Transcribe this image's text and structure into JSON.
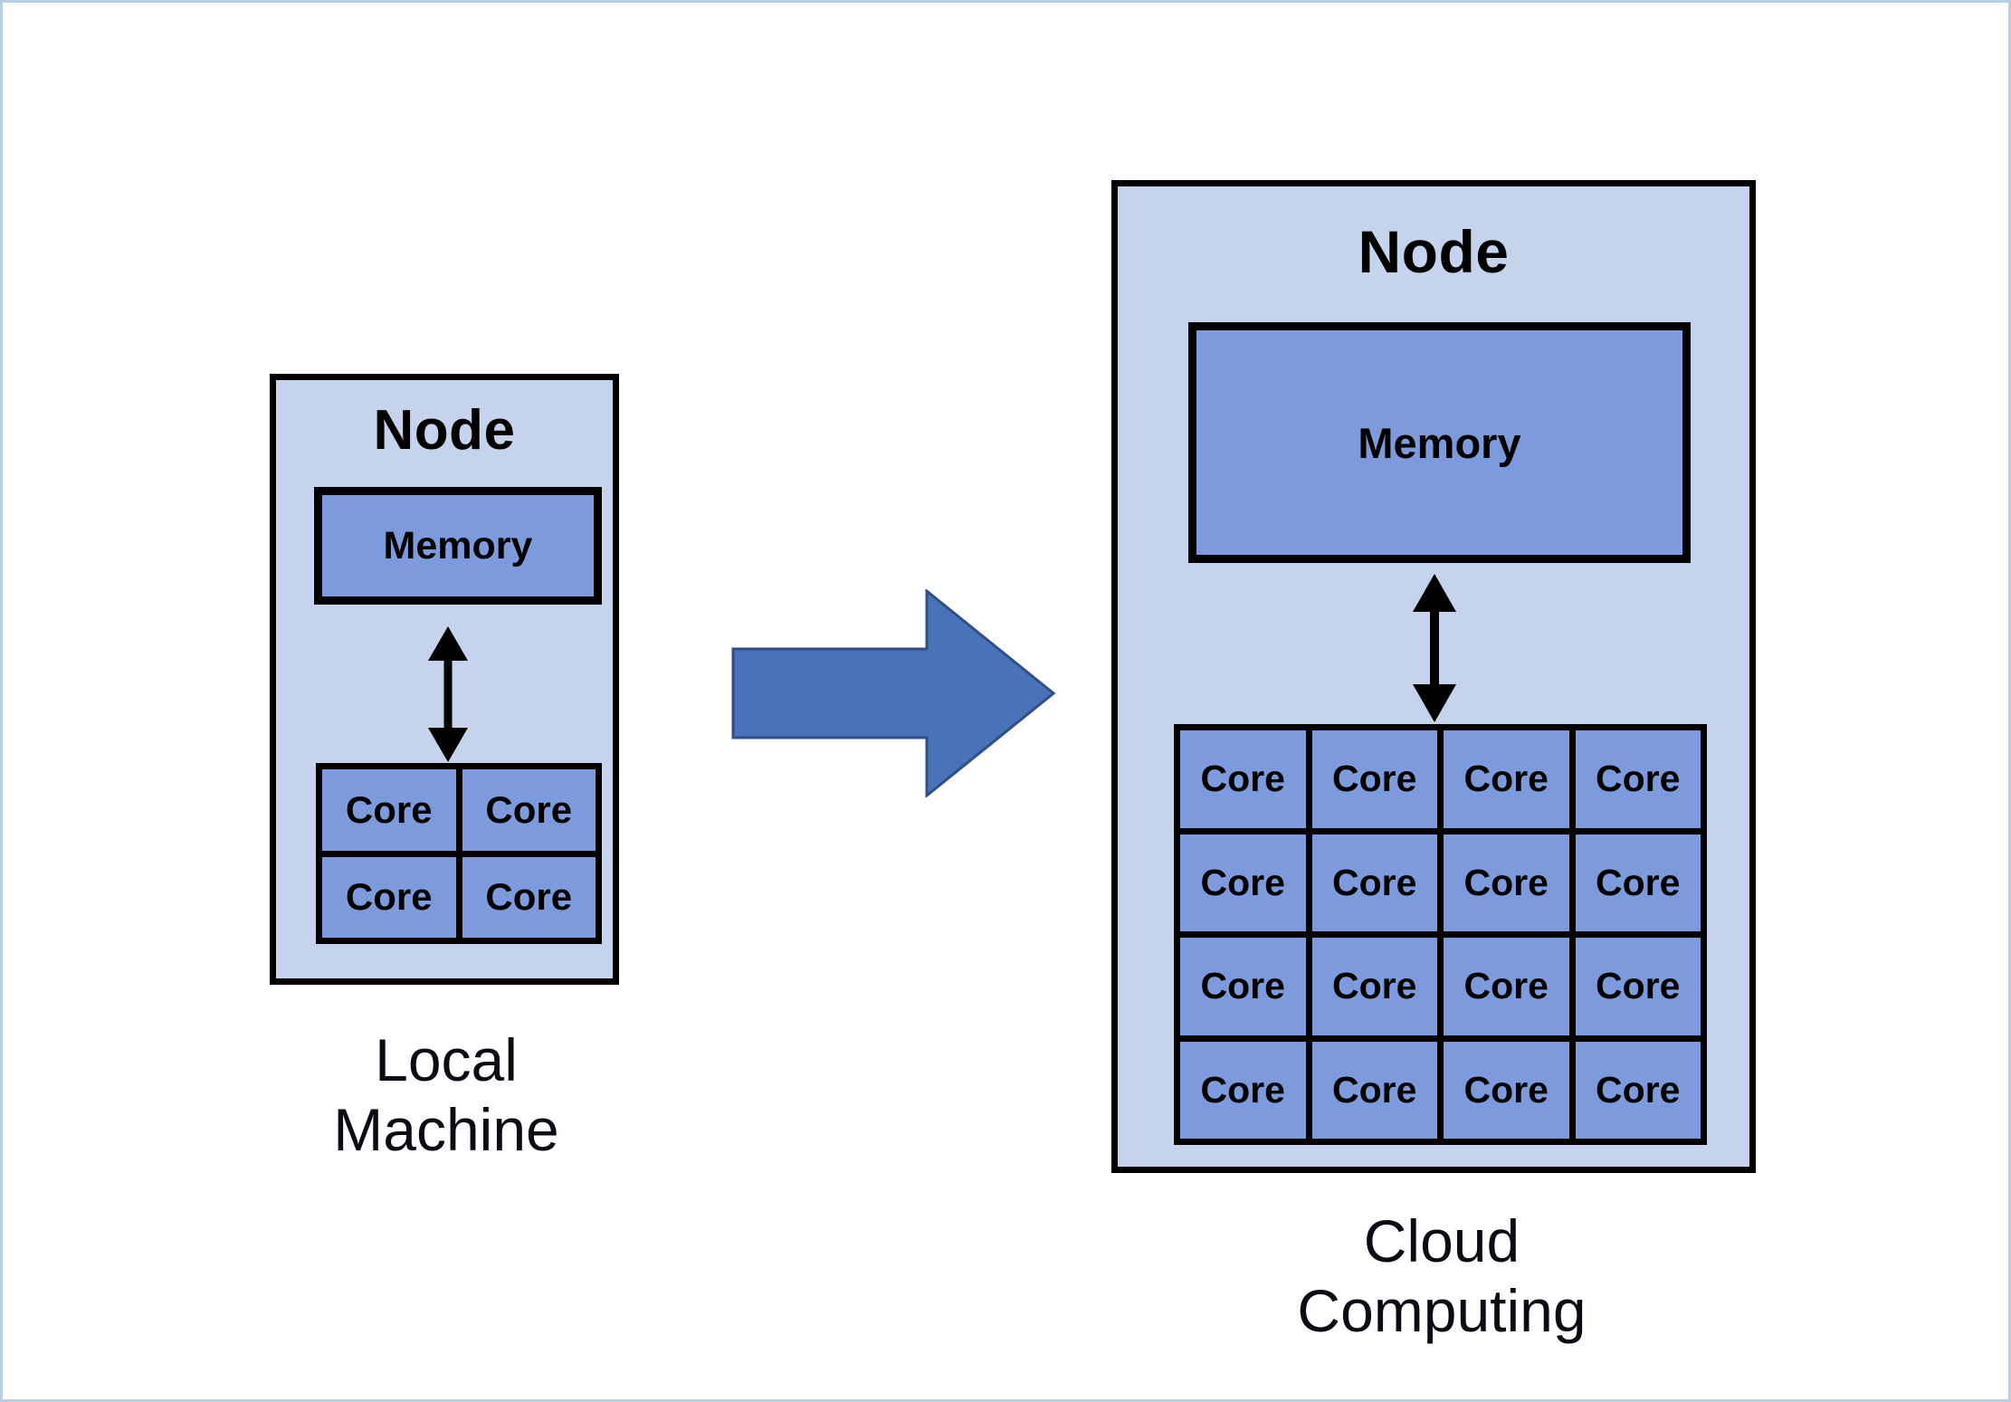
{
  "diagram": {
    "title_hidden": "Local machine vs cloud computing node comparison",
    "colors": {
      "node_fill": "#C6D3EC",
      "block_fill": "#7D9BDC",
      "outline": "#000000",
      "block_arrow_fill": "#4A72B8",
      "block_arrow_stroke": "#2F4F86",
      "frame_border": "#B9CEE2",
      "background": "#FFFFFF"
    }
  },
  "left": {
    "node_title": "Node",
    "memory_label": "Memory",
    "memory_arrow_icon": "double-headed-vertical-arrow-icon",
    "cores": [
      "Core",
      "Core",
      "Core",
      "Core"
    ],
    "core_grid": {
      "rows": 2,
      "cols": 2,
      "count": 4
    },
    "caption": "Local\nMachine"
  },
  "transition": {
    "arrow_icon": "right-block-arrow-icon",
    "direction": "right"
  },
  "right": {
    "node_title": "Node",
    "memory_label": "Memory",
    "memory_arrow_icon": "double-headed-vertical-arrow-icon",
    "cores": [
      "Core",
      "Core",
      "Core",
      "Core",
      "Core",
      "Core",
      "Core",
      "Core",
      "Core",
      "Core",
      "Core",
      "Core",
      "Core",
      "Core",
      "Core",
      "Core"
    ],
    "core_grid": {
      "rows": 4,
      "cols": 4,
      "count": 16
    },
    "caption": "Cloud\nComputing"
  }
}
